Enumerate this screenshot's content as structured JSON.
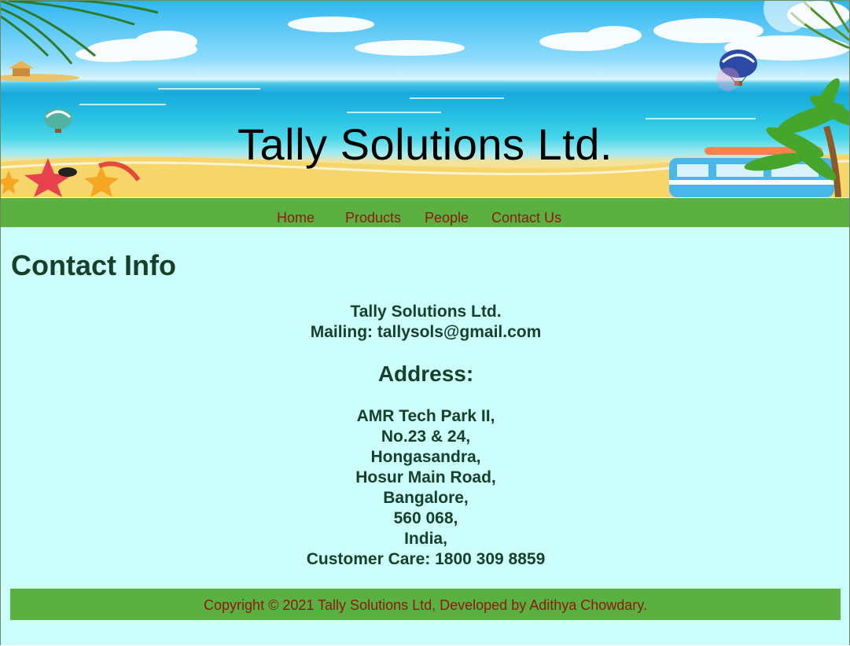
{
  "banner": {
    "title": "Tally Solutions Ltd."
  },
  "nav": {
    "items": [
      {
        "label": "Home"
      },
      {
        "label": "Products"
      },
      {
        "label": "People"
      },
      {
        "label": "Contact Us"
      }
    ]
  },
  "main": {
    "title": "Contact Info",
    "company_name": "Tally Solutions Ltd.",
    "mailing": "Mailing: tallysols@gmail.com",
    "address_heading": "Address:",
    "address_lines": [
      "AMR Tech Park II,",
      "No.23 & 24,",
      "Hongasandra,",
      "Hosur Main Road,",
      "Bangalore,",
      "560 068,",
      "India,",
      "Customer Care: 1800 309 8859"
    ]
  },
  "footer": {
    "text": "Copyright © 2021 Tally Solutions Ltd, Developed by Adithya Chowdary."
  },
  "colors": {
    "nav_bg": "#5ab142",
    "nav_link": "#8b1a0f",
    "content_bg": "#ccfefc",
    "heading_text": "#17402a"
  }
}
